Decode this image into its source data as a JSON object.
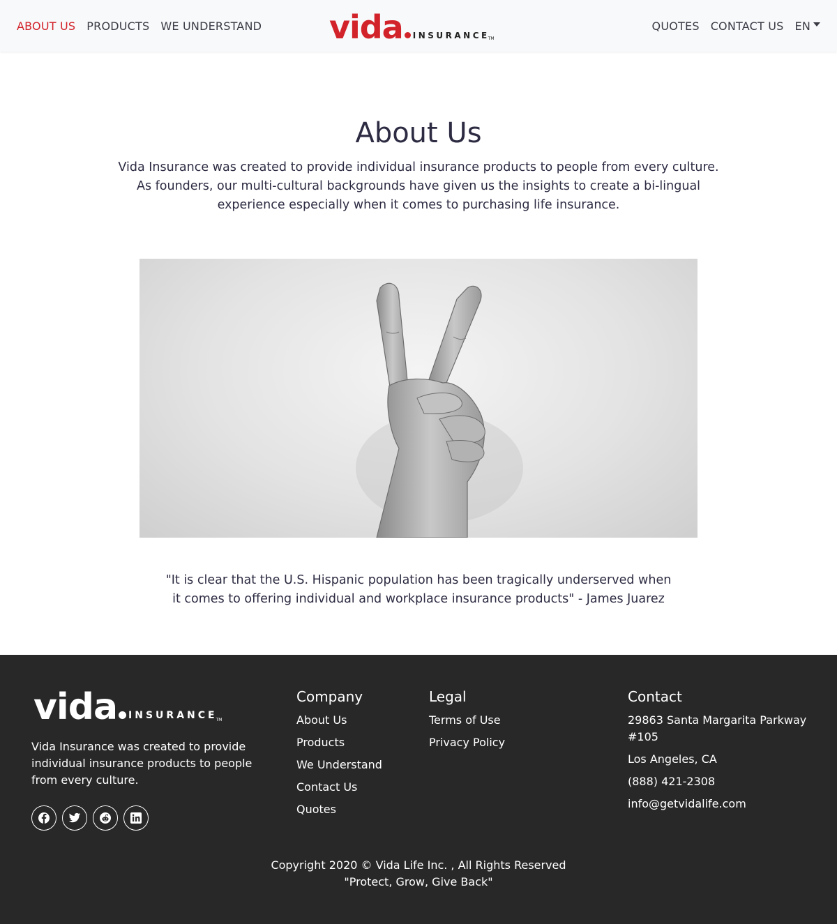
{
  "nav": {
    "left": [
      {
        "label": "ABOUT US",
        "active": true
      },
      {
        "label": "PRODUCTS",
        "active": false
      },
      {
        "label": "WE UNDERSTAND",
        "active": false
      }
    ],
    "right": [
      {
        "label": "QUOTES"
      },
      {
        "label": "CONTACT US"
      }
    ],
    "language": "EN"
  },
  "logo": {
    "word": "vida",
    "sub": "INSURANCE",
    "tm": "TM"
  },
  "colors": {
    "brand_red": "#d2232a",
    "footer_bg": "#282828",
    "nav_bg": "#f8f9fa"
  },
  "main": {
    "title": "About Us",
    "intro": "Vida Insurance was created to provide individual insurance products to people from every culture. As founders, our multi-cultural backgrounds have given us the insights to create a bi-lingual experience especially when it comes to purchasing life insurance.",
    "quote": "\"It is clear that the U.S. Hispanic population has been tragically underserved when it comes to offering individual and workplace insurance products\" - James Juarez"
  },
  "footer": {
    "description": "Vida Insurance was created to provide individual insurance products to people from every culture.",
    "social": [
      "facebook-icon",
      "twitter-icon",
      "reddit-icon",
      "linkedin-icon"
    ],
    "company": {
      "heading": "Company",
      "links": [
        "About Us",
        "Products",
        "We Understand",
        "Contact Us",
        "Quotes"
      ]
    },
    "legal": {
      "heading": "Legal",
      "links": [
        "Terms of Use",
        "Privacy Policy"
      ]
    },
    "contact": {
      "heading": "Contact",
      "address": "29863 Santa Margarita Parkway #105",
      "city": "Los Angeles, CA",
      "phone": "(888) 421-2308",
      "email": "info@getvidalife.com"
    },
    "copyright": "Copyright 2020 © Vida Life Inc. , All Rights Reserved",
    "tagline": "\"Protect, Grow, Give Back\""
  }
}
